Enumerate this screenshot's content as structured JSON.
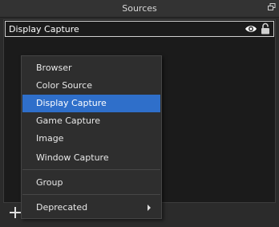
{
  "dock": {
    "title": "Sources"
  },
  "sources": [
    {
      "name": "Display Capture",
      "visible": true,
      "locked": false
    }
  ],
  "menu": {
    "items": [
      {
        "label": "Browser"
      },
      {
        "label": "Color Source"
      },
      {
        "label": "Display Capture",
        "selected": true
      },
      {
        "label": "Game Capture"
      },
      {
        "label": "Image"
      },
      {
        "label": "Window Capture"
      },
      {
        "label": "Group"
      },
      {
        "label": "Deprecated",
        "has_submenu": true
      }
    ]
  },
  "icons": {
    "float": "float-dock-icon",
    "visibility": "eye-icon",
    "lock": "lock-icon",
    "add": "plus-icon",
    "submenu": "chevron-right-icon"
  },
  "colors": {
    "selection": "#2f6fca",
    "panel_bg": "#1b1b1b",
    "window_bg": "#2b2b2b"
  }
}
